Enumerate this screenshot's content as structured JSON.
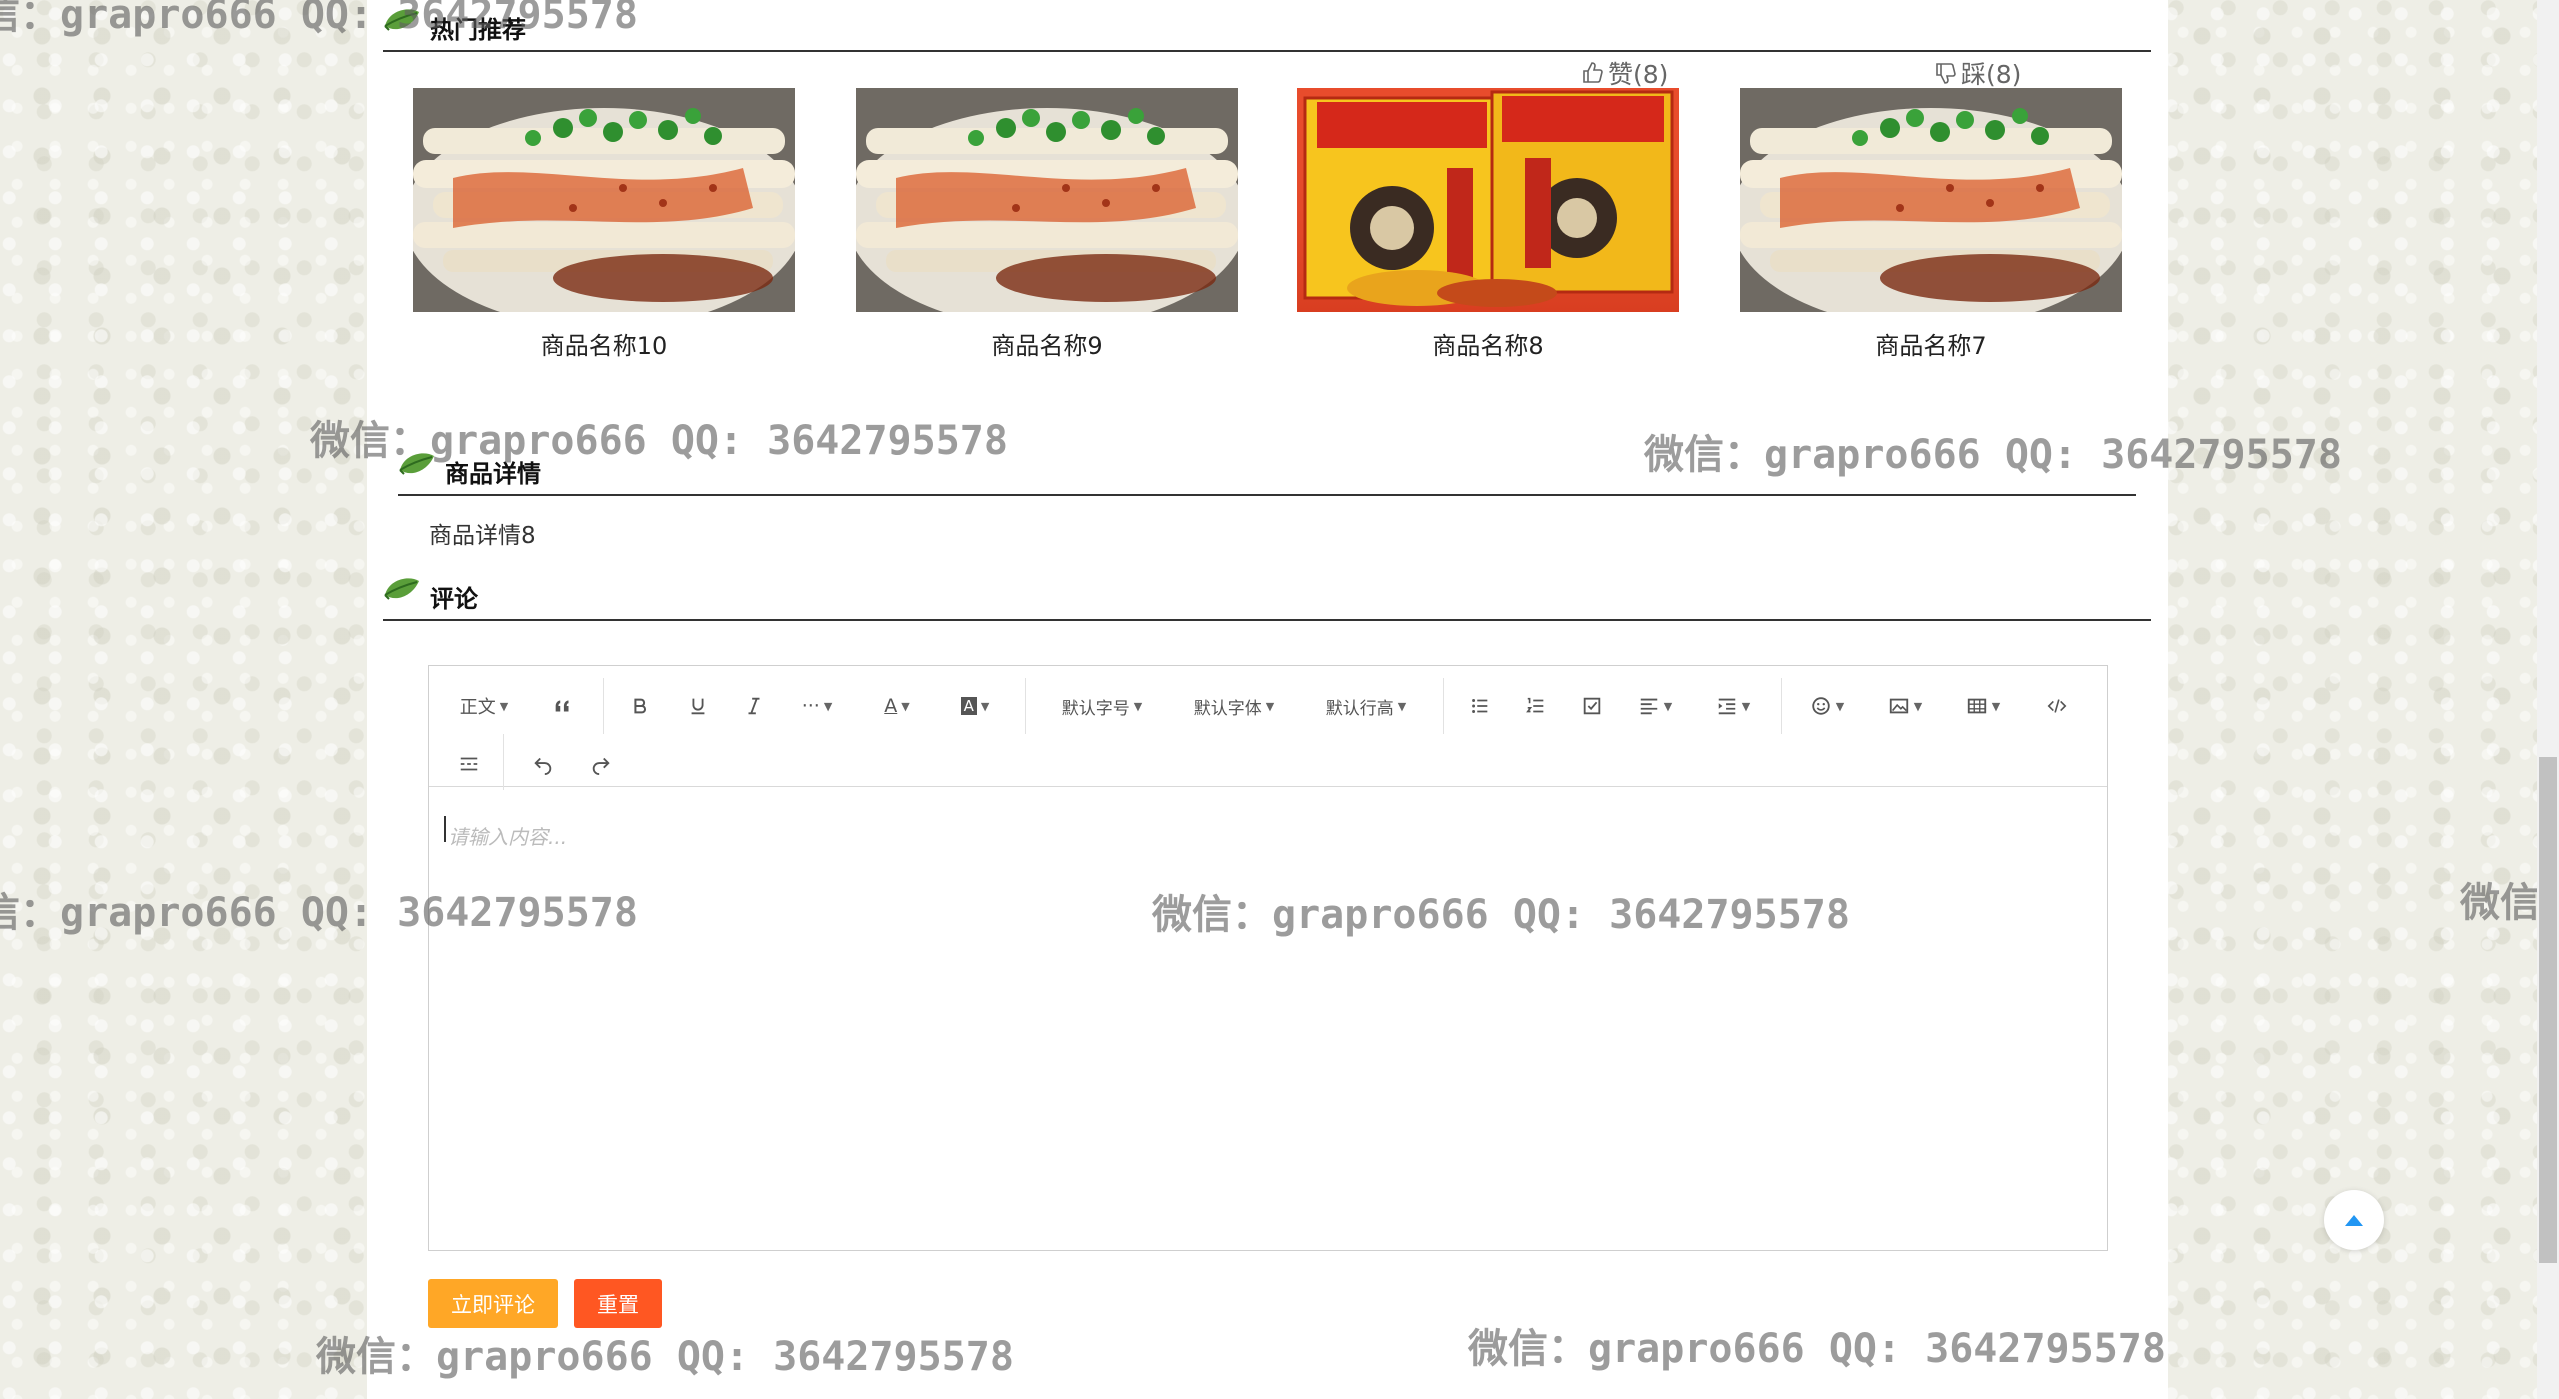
{
  "sections": {
    "hot": "热门推荐",
    "detail": "商品详情",
    "comment": "评论"
  },
  "products": [
    {
      "name": "商品名称10",
      "image": "liangpi-dish"
    },
    {
      "name": "商品名称9",
      "image": "liangpi-dish"
    },
    {
      "name": "商品名称8",
      "image": "gift-box"
    },
    {
      "name": "商品名称7",
      "image": "liangpi-dish"
    }
  ],
  "votes": {
    "like": "赞(8)",
    "dislike": "踩(8)"
  },
  "detail_text": "商品详情8",
  "editor": {
    "toolbar": {
      "paragraph": "正文",
      "font_size": "默认字号",
      "font_family": "默认字体",
      "line_height": "默认行高"
    },
    "placeholder": "请输入内容..."
  },
  "buttons": {
    "submit": "立即评论",
    "reset": "重置"
  },
  "watermark": "微信：grapro666 QQ: 3642795578",
  "colors": {
    "submit": "#ffa726",
    "reset": "#ff5722",
    "leaf": "#4caf50"
  }
}
